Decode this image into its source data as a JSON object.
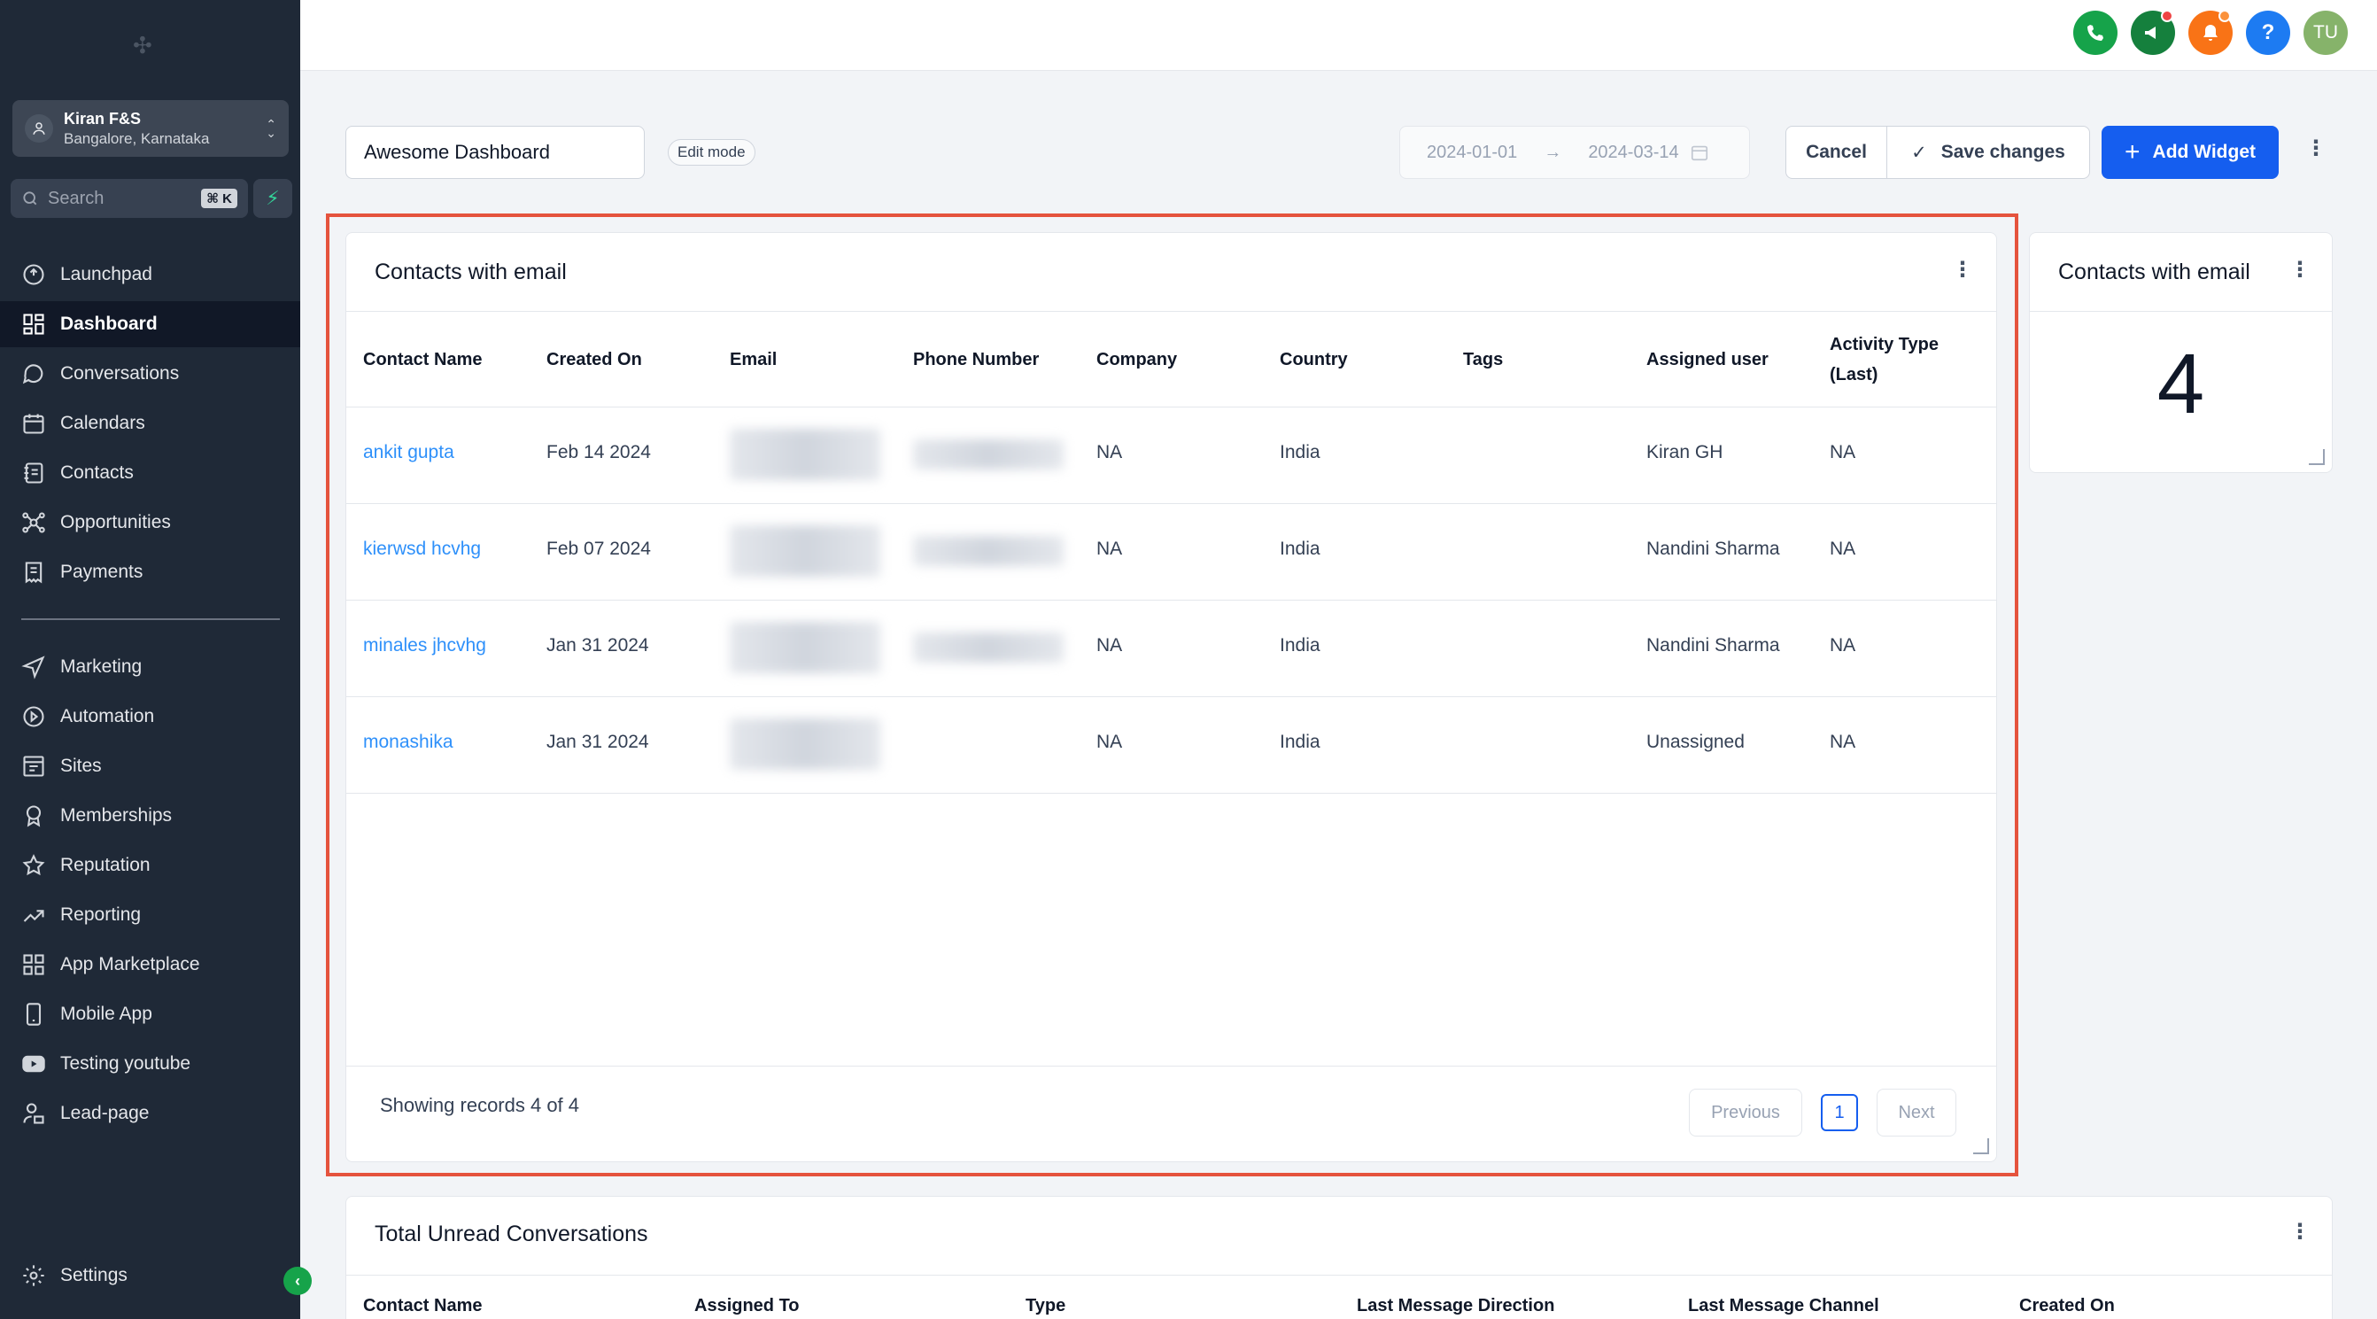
{
  "sidebar": {
    "account": {
      "name": "Kiran F&S",
      "location": "Bangalore, Karnataka"
    },
    "search": {
      "placeholder": "Search",
      "shortcut": "⌘ K"
    },
    "items": [
      {
        "label": "Launchpad",
        "icon": "rocket-icon"
      },
      {
        "label": "Dashboard",
        "icon": "grid-icon",
        "active": true
      },
      {
        "label": "Conversations",
        "icon": "chat-icon"
      },
      {
        "label": "Calendars",
        "icon": "calendar-icon"
      },
      {
        "label": "Contacts",
        "icon": "contacts-icon"
      },
      {
        "label": "Opportunities",
        "icon": "network-icon"
      },
      {
        "label": "Payments",
        "icon": "receipt-icon"
      },
      {
        "label": "Marketing",
        "icon": "send-icon"
      },
      {
        "label": "Automation",
        "icon": "automation-icon"
      },
      {
        "label": "Sites",
        "icon": "sites-icon"
      },
      {
        "label": "Memberships",
        "icon": "badge-icon"
      },
      {
        "label": "Reputation",
        "icon": "star-icon"
      },
      {
        "label": "Reporting",
        "icon": "trend-icon"
      },
      {
        "label": "App Marketplace",
        "icon": "apps-icon"
      },
      {
        "label": "Mobile App",
        "icon": "mobile-icon"
      },
      {
        "label": "Testing youtube",
        "icon": "youtube-icon"
      },
      {
        "label": "Lead-page",
        "icon": "user-lock-icon"
      }
    ],
    "settings": "Settings"
  },
  "header": {
    "avatar_initials": "TU",
    "colors": {
      "phone": "#16a34a",
      "megaphone": "#15803d",
      "bell": "#f97316",
      "help": "#1d7bf2",
      "avatar": "#86b36a"
    }
  },
  "toolbar": {
    "dashboard_name": "Awesome Dashboard",
    "mode_badge": "Edit mode",
    "date_start": "2024-01-01",
    "date_end": "2024-03-14",
    "cancel_label": "Cancel",
    "save_label": "Save changes",
    "add_widget_label": "Add Widget"
  },
  "contacts_widget": {
    "title": "Contacts with email",
    "columns": [
      "Contact Name",
      "Created On",
      "Email",
      "Phone Number",
      "Company",
      "Country",
      "Tags",
      "Assigned user",
      "Activity Type (Last)"
    ],
    "rows": [
      {
        "name": "ankit gupta",
        "created": "Feb 14 2024",
        "company": "NA",
        "country": "India",
        "tags": "",
        "assigned": "Kiran GH",
        "activity": "NA"
      },
      {
        "name": "kierwsd hcvhg",
        "created": "Feb 07 2024",
        "company": "NA",
        "country": "India",
        "tags": "",
        "assigned": "Nandini Sharma",
        "activity": "NA"
      },
      {
        "name": "minales jhcvhg",
        "created": "Jan 31 2024",
        "company": "NA",
        "country": "India",
        "tags": "",
        "assigned": "Nandini Sharma",
        "activity": "NA"
      },
      {
        "name": "monashika",
        "created": "Jan 31 2024",
        "company": "NA",
        "country": "India",
        "tags": "",
        "assigned": "Unassigned",
        "activity": "NA"
      }
    ],
    "footer": "Showing records 4 of 4",
    "pagination": {
      "previous": "Previous",
      "page": "1",
      "next": "Next"
    }
  },
  "count_widget": {
    "title": "Contacts with email",
    "value": "4"
  },
  "unread_widget": {
    "title": "Total Unread Conversations",
    "columns": [
      "Contact Name",
      "Assigned To",
      "Type",
      "Last Message Direction",
      "Last Message Channel",
      "Created On"
    ]
  }
}
